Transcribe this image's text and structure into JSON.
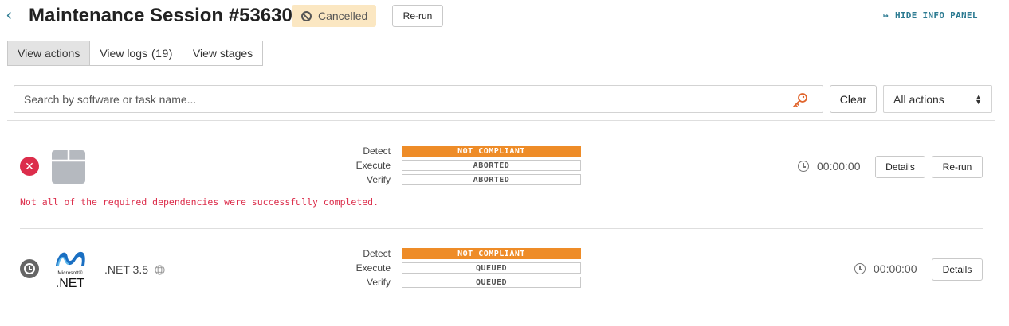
{
  "header": {
    "back_icon": "chevron-left-icon",
    "title": "Maintenance Session #53630",
    "status": "Cancelled",
    "status_icon": "ban-icon",
    "rerun_label": "Re-run",
    "hide_panel_label": "HIDE INFO PANEL",
    "hide_panel_icon": "panel-collapse-icon"
  },
  "tabs": [
    {
      "label": "View actions",
      "active": true
    },
    {
      "label": "View logs",
      "count": "(19)",
      "active": false
    },
    {
      "label": "View stages",
      "active": false
    }
  ],
  "search": {
    "placeholder": "Search by software or task name...",
    "value": "",
    "icon": "key-icon",
    "clear_label": "Clear"
  },
  "filter": {
    "selected": "All actions"
  },
  "actions": [
    {
      "status_icon": "failed-x-icon",
      "software_icon": "package-icon",
      "software_name": "",
      "stages": {
        "labels": [
          "Detect",
          "Execute",
          "Verify"
        ],
        "values": [
          "NOT COMPLIANT",
          "ABORTED",
          "ABORTED"
        ]
      },
      "duration": "00:00:00",
      "details_label": "Details",
      "rerun_label": "Re-run",
      "error": "Not all of the required dependencies were successfully completed."
    },
    {
      "status_icon": "queued-clock-icon",
      "software_icon": "microsoft-net-logo",
      "logo_text_top": "Microsoft®",
      "logo_text_bottom": ".NET",
      "software_name": ".NET 3.5",
      "stages": {
        "labels": [
          "Detect",
          "Execute",
          "Verify"
        ],
        "values": [
          "NOT COMPLIANT",
          "QUEUED",
          "QUEUED"
        ]
      },
      "duration": "00:00:00",
      "details_label": "Details"
    }
  ],
  "colors": {
    "accent": "#2b7a91",
    "badge_bg": "#fbe7c2",
    "not_compliant": "#ee8c28",
    "error": "#dc2d4b"
  }
}
